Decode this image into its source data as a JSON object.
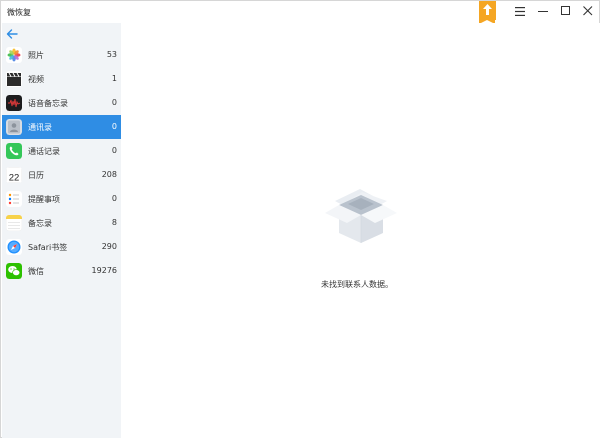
{
  "app": {
    "title": "微恢复"
  },
  "sidebar": {
    "items": [
      {
        "label": "照片",
        "count": "53",
        "icon": "photos-icon",
        "active": false
      },
      {
        "label": "视频",
        "count": "1",
        "icon": "video-clapper-icon",
        "active": false
      },
      {
        "label": "语音备忘录",
        "count": "0",
        "icon": "voice-memo-icon",
        "active": false
      },
      {
        "label": "通讯录",
        "count": "0",
        "icon": "contacts-icon",
        "active": true
      },
      {
        "label": "通话记录",
        "count": "0",
        "icon": "phone-icon",
        "active": false
      },
      {
        "label": "日历",
        "count": "208",
        "icon": "calendar-icon",
        "active": false
      },
      {
        "label": "提醒事项",
        "count": "0",
        "icon": "reminders-icon",
        "active": false
      },
      {
        "label": "备忘录",
        "count": "8",
        "icon": "notes-icon",
        "active": false
      },
      {
        "label": "Safari书签",
        "count": "290",
        "icon": "safari-icon",
        "active": false
      },
      {
        "label": "微信",
        "count": "19276",
        "icon": "wechat-icon",
        "active": false
      }
    ],
    "calendar_day": "22"
  },
  "main": {
    "empty_message": "未找到联系人数据。",
    "empty_icon": "empty-box-icon"
  },
  "colors": {
    "accent": "#2f8de4",
    "upgrade": "#f5a623",
    "sidebar_bg": "#f1f4f7"
  }
}
